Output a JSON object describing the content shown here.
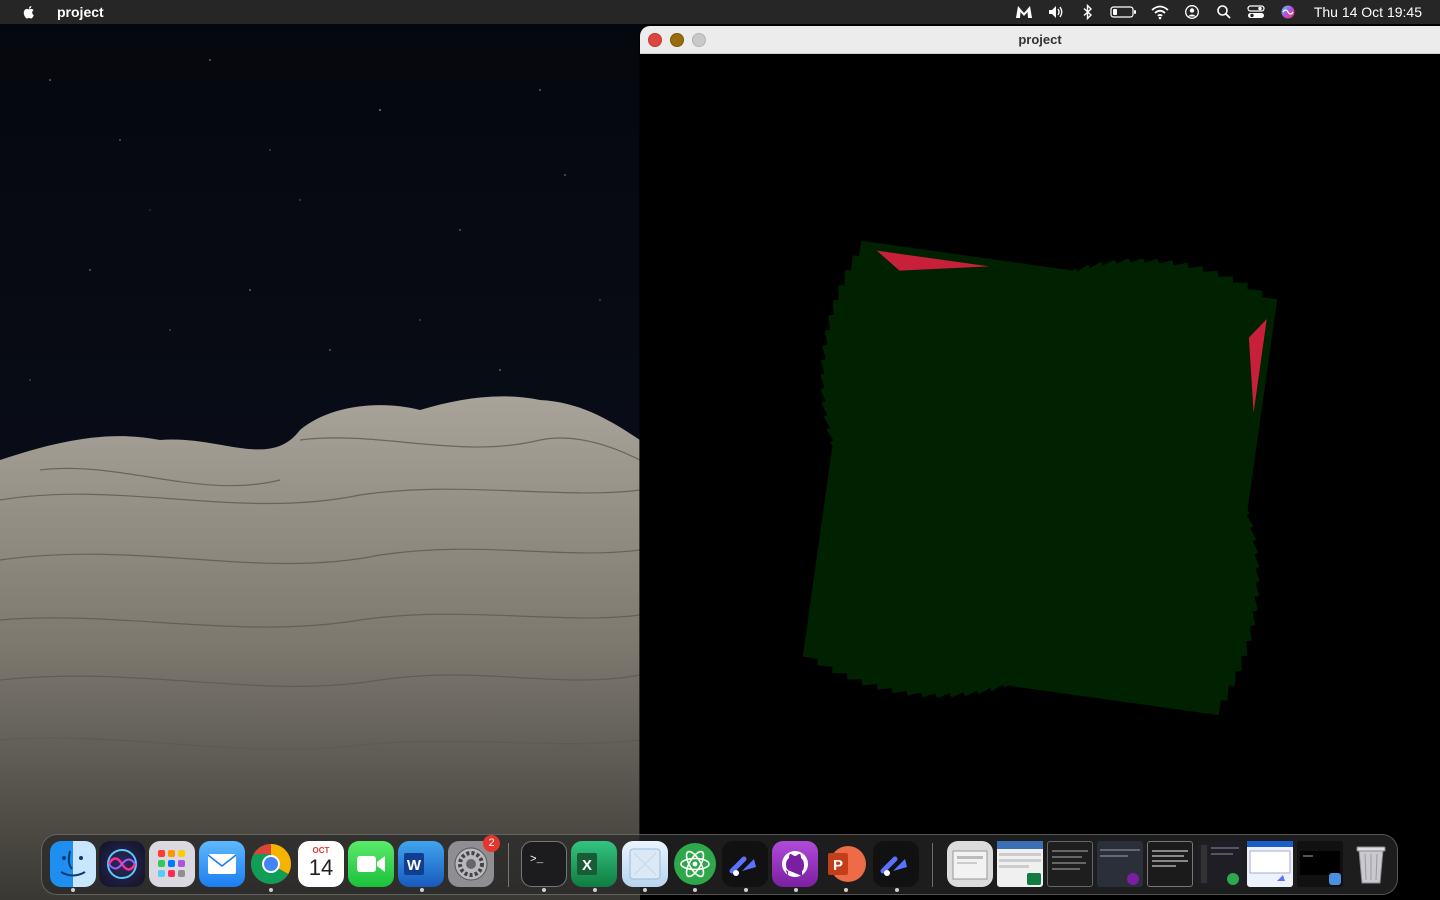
{
  "menubar": {
    "app_name": "project",
    "clock": "Thu 14 Oct  19:45",
    "status_icons": [
      "malwarebytes-icon",
      "volume-icon",
      "bluetooth-icon",
      "battery-icon",
      "wifi-icon",
      "user-icon",
      "spotlight-icon",
      "control-center-icon",
      "siri-icon"
    ]
  },
  "window": {
    "title": "project",
    "colors": {
      "square_fill": "#002200",
      "stripe_red": "#c8203a",
      "stripe_purple": "#6a1a55"
    }
  },
  "dock": {
    "apps": [
      {
        "name": "finder",
        "running": true
      },
      {
        "name": "siri",
        "running": false
      },
      {
        "name": "launchpad",
        "running": false
      },
      {
        "name": "mail",
        "running": false
      },
      {
        "name": "chrome",
        "running": true
      },
      {
        "name": "calendar",
        "running": false
      },
      {
        "name": "facetime",
        "running": false
      },
      {
        "name": "word",
        "running": true
      },
      {
        "name": "system-preferences",
        "running": false
      },
      {
        "name": "terminal",
        "running": true
      },
      {
        "name": "excel",
        "running": true
      },
      {
        "name": "preview",
        "running": true
      },
      {
        "name": "atom",
        "running": true
      },
      {
        "name": "processing",
        "running": true
      },
      {
        "name": "github-desktop",
        "running": true
      },
      {
        "name": "powerpoint",
        "running": true
      },
      {
        "name": "processing-2",
        "running": true
      }
    ],
    "calendar": {
      "month": "OCT",
      "day": "14"
    },
    "system_preferences_badge": "2"
  }
}
